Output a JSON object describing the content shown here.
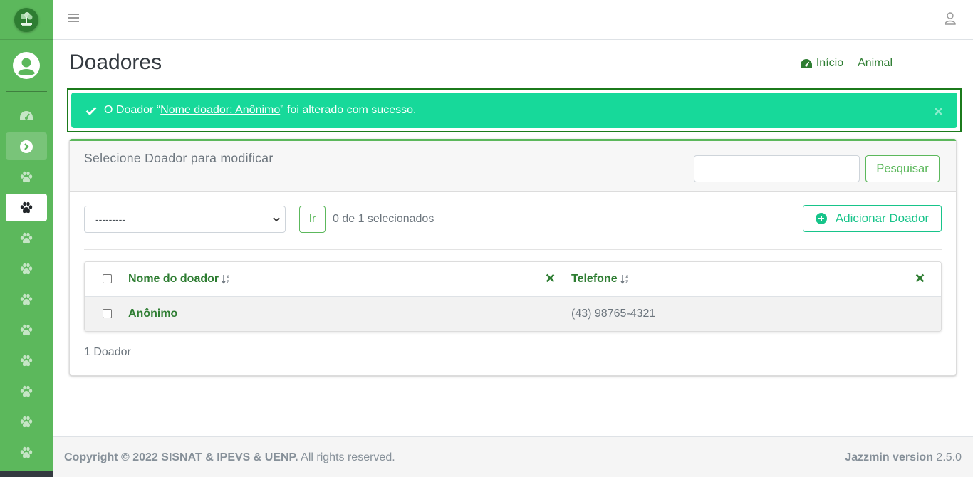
{
  "app": {
    "brand_icon": "tree-logo-icon",
    "accent_color": "#5cb85c",
    "success_color": "#17d99a"
  },
  "sidebar": {
    "items": [
      {
        "icon": "dashboard-icon"
      },
      {
        "icon": "chevron-circle-right-icon"
      },
      {
        "icon": "paw-icon"
      },
      {
        "icon": "paw-icon",
        "active": true
      },
      {
        "icon": "paw-icon"
      },
      {
        "icon": "paw-icon"
      },
      {
        "icon": "paw-icon"
      },
      {
        "icon": "paw-icon"
      },
      {
        "icon": "paw-icon"
      },
      {
        "icon": "paw-icon"
      },
      {
        "icon": "paw-icon"
      },
      {
        "icon": "users-cog-icon"
      }
    ]
  },
  "page": {
    "title": "Doadores"
  },
  "breadcrumb": {
    "home": "Início",
    "current": "Animal"
  },
  "alert": {
    "prefix": "O Doador “",
    "link": "Nome doador: Anônimo ",
    "suffix": "” foi alterado com sucesso.",
    "close": "×"
  },
  "card": {
    "title": "Selecione Doador para modificar",
    "search_button": "Pesquisar",
    "action_select": "---------",
    "go_button": "Ir",
    "selected_count": "0 de 1 selecionados",
    "add_button": "Adicionar Doador",
    "total": "1 Doador"
  },
  "table": {
    "columns": [
      "Nome do doador",
      "Telefone"
    ],
    "rows": [
      {
        "name": "Anônimo",
        "phone": "(43) 98765-4321"
      }
    ]
  },
  "footer": {
    "copyright_bold": "Copyright © 2022 SISNAT & IPEVS & UENP.",
    "copyright_rest": " All rights reserved.",
    "version_label": "Jazzmin version",
    "version_value": " 2.5.0"
  }
}
